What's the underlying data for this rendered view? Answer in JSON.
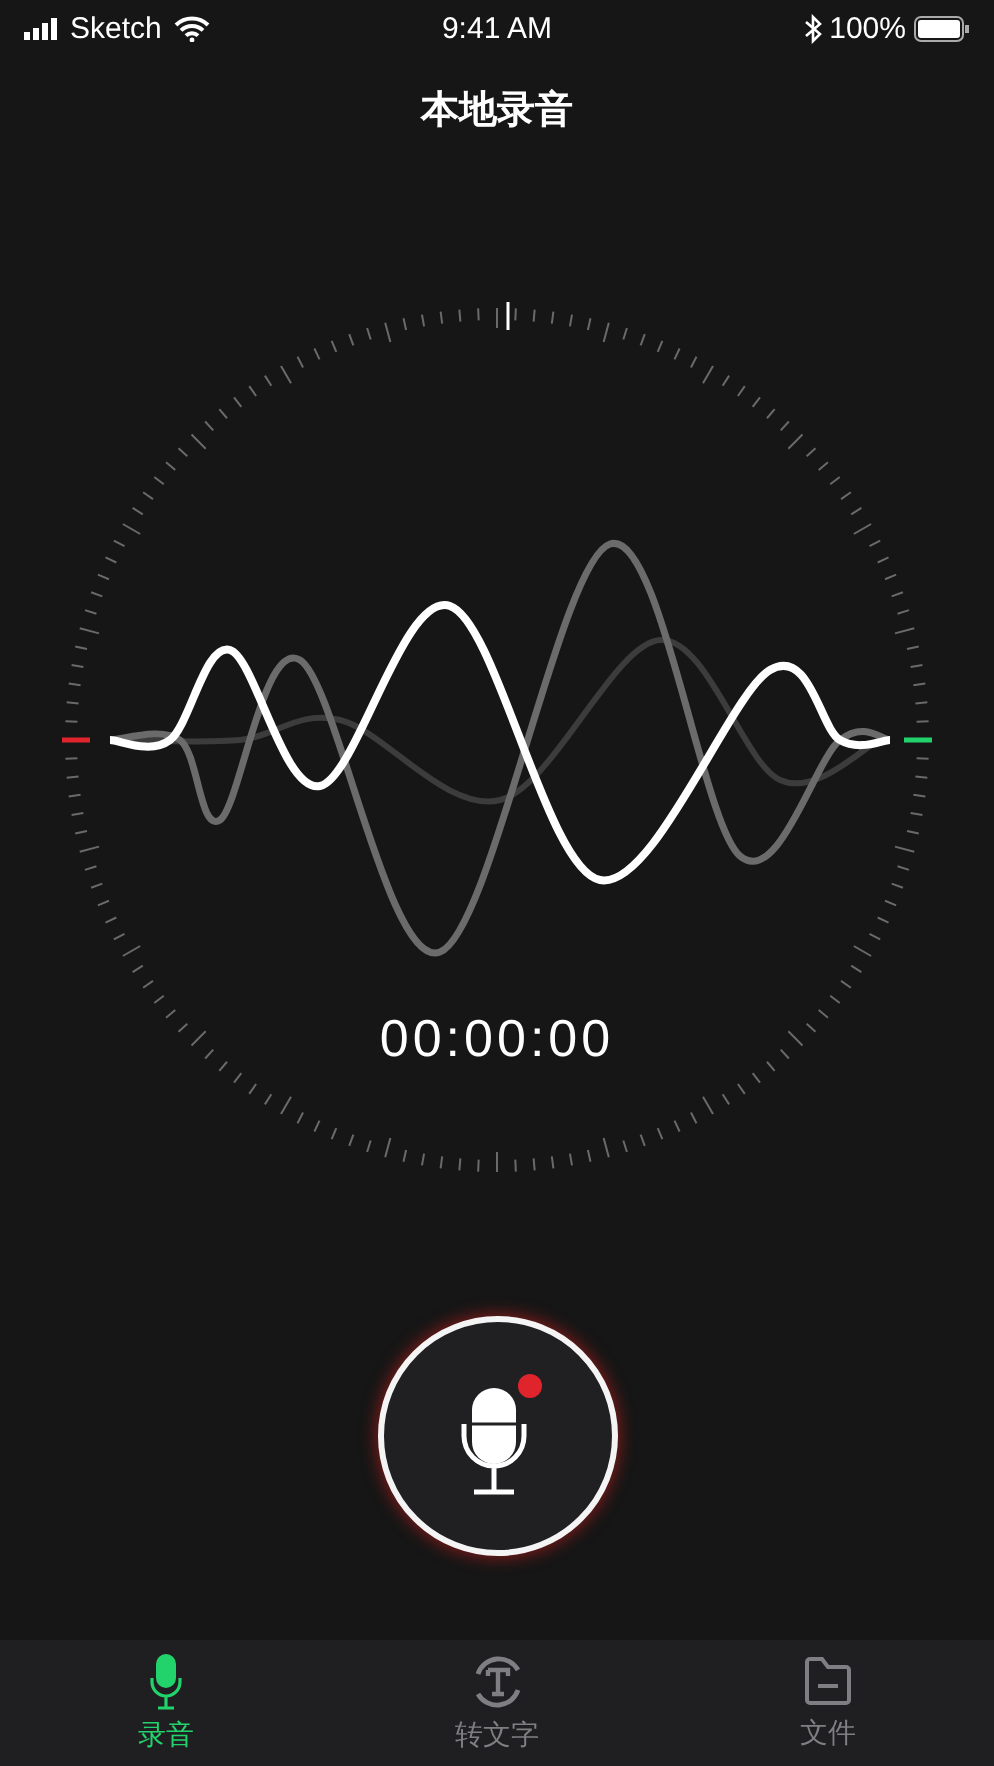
{
  "status_bar": {
    "carrier": "Sketch",
    "time": "9:41 AM",
    "battery": "100%"
  },
  "title": "本地录音",
  "timer": "00:00:00",
  "tabs": [
    {
      "label": "录音",
      "kind": "mic",
      "selected": true
    },
    {
      "label": "转文字",
      "kind": "text",
      "selected": false
    },
    {
      "label": "文件",
      "kind": "folder",
      "selected": false
    }
  ]
}
